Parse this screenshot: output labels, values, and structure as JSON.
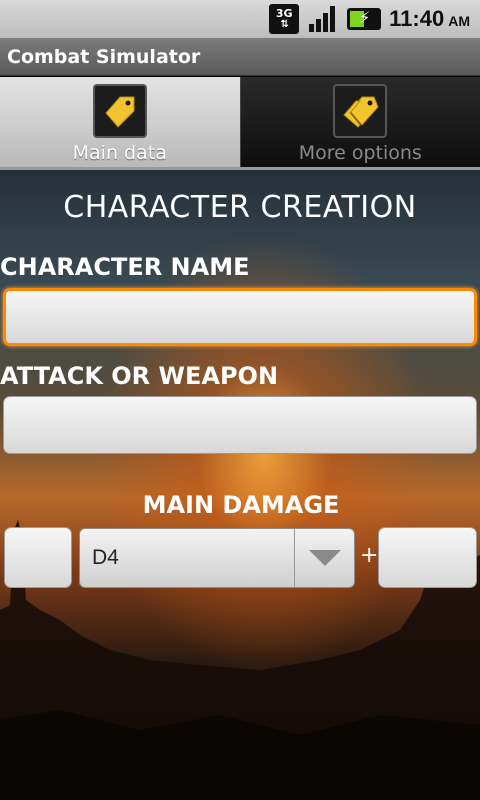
{
  "status_bar": {
    "network": "3G",
    "time": "11:40",
    "ampm": "AM"
  },
  "app": {
    "title": "Combat Simulator"
  },
  "tabs": [
    {
      "label": "Main data",
      "active": true
    },
    {
      "label": "More options",
      "active": false
    }
  ],
  "form": {
    "heading": "CHARACTER CREATION",
    "character_name": {
      "label": "CHARACTER NAME",
      "value": ""
    },
    "attack": {
      "label": "ATTACK OR WEAPON",
      "value": ""
    },
    "main_damage": {
      "label": "MAIN DAMAGE",
      "count_value": "",
      "die_selected": "D4",
      "plus": "+",
      "bonus_value": ""
    }
  },
  "colors": {
    "focus": "#ff8a00",
    "tab_active": "#d0d0d0",
    "tab_inactive": "#111111",
    "tag_icon": "#f4c430"
  }
}
